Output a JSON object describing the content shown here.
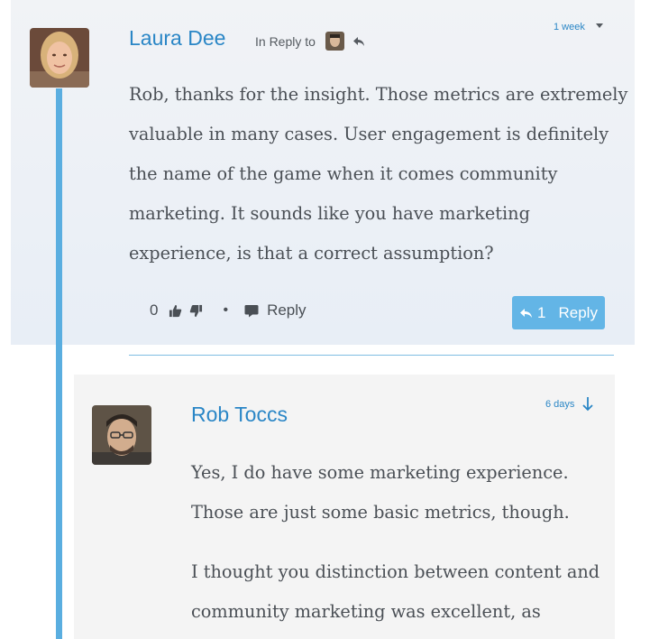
{
  "parent_comment": {
    "author": "Laura Dee",
    "in_reply_to_label": "In Reply to",
    "time": "1 week",
    "body": "Rob, thanks for the insight. Those metrics are extremely valuable in many cases. User engagement is definitely the name of the game when it comes community marketing. It sounds like you have marketing experience, is that a correct assumption?",
    "vote_count": "0",
    "reply_link_label": "Reply",
    "replies_button": {
      "count": "1",
      "label": "Reply"
    }
  },
  "child_comment": {
    "author": "Rob Toccs",
    "time": "6 days",
    "paragraphs": [
      "Yes, I do have some marketing experience. Those are just some basic metrics, though.",
      "I thought you distinction between content and community marketing was excellent, as"
    ]
  },
  "colors": {
    "accent": "#2a86c6",
    "thread_line": "#5aaee0",
    "button": "#63b5e6"
  },
  "icons": {
    "reply": "reply-arrow-icon",
    "thumbs_up": "thumbs-up-icon",
    "thumbs_down": "thumbs-down-icon",
    "comment": "comment-icon",
    "caret": "caret-down-icon",
    "arrow_down": "arrow-down-icon"
  }
}
